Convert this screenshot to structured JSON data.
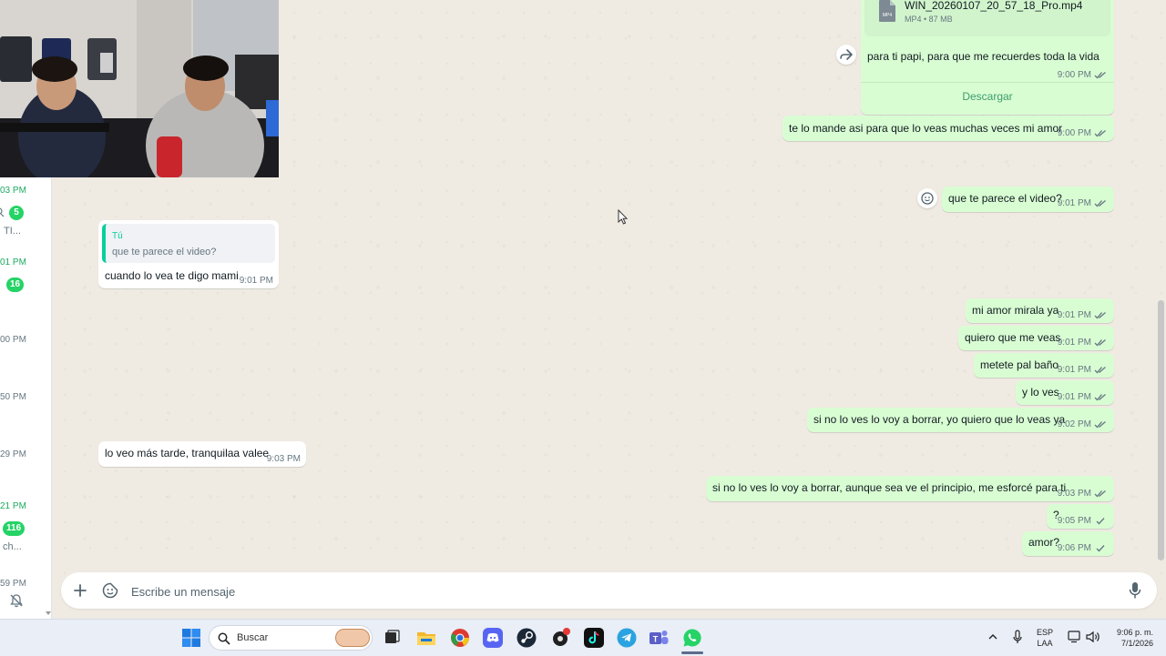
{
  "sidebar_strip": {
    "times": [
      "03 PM",
      "01 PM",
      "00 PM",
      "50 PM",
      "29 PM",
      "21 PM",
      "59 PM"
    ],
    "badges": [
      "5",
      "16",
      "116"
    ],
    "snippets": [
      "TI...",
      "ch..."
    ]
  },
  "messages": {
    "video_file": {
      "name": "WIN_20260107_20_57_18_Pro.mp4",
      "info": "MP4 • 87 MB",
      "icon_label": "MP4",
      "caption": "para ti papi, para que me recuerdes toda la vida",
      "time": "9:00 PM",
      "download_label": "Descargar"
    },
    "m1": {
      "text": "te lo mande asi para que lo veas muchas veces mi amor",
      "time": "9:00 PM"
    },
    "m2": {
      "text": "que te parece el video?",
      "time": "9:01 PM"
    },
    "reply": {
      "quote_author": "Tú",
      "quote_text": "que te parece el video?",
      "text": "cuando lo vea te digo mami",
      "time": "9:01 PM"
    },
    "m3": {
      "text": "mi amor mirala ya",
      "time": "9:01 PM"
    },
    "m4": {
      "text": "quiero que me veas",
      "time": "9:01 PM"
    },
    "m5": {
      "text": "metete pal baño",
      "time": "9:01 PM"
    },
    "m6": {
      "text": "y lo ves",
      "time": "9:01 PM"
    },
    "m7": {
      "text": "si no lo ves lo voy a borrar, yo quiero que lo veas ya",
      "time": "9:02 PM"
    },
    "incoming2": {
      "text": "lo veo más tarde, tranquilaa valee",
      "time": "9:03 PM"
    },
    "m8": {
      "text": "si no lo ves lo voy a borrar, aunque sea ve el principio, me esforcé para ti",
      "time": "9:03 PM"
    },
    "m9": {
      "text": "?",
      "time": "9:05 PM"
    },
    "m10": {
      "text": "amor?",
      "time": "9:06 PM"
    }
  },
  "composer": {
    "placeholder": "Escribe un mensaje"
  },
  "taskbar": {
    "search_label": "Buscar",
    "lang_top": "ESP",
    "lang_bottom": "LAA",
    "clock_time": "9:06 p. m.",
    "clock_date": "7/1/2026"
  },
  "colors": {
    "outgoing_bubble": "#d9fdd3",
    "incoming_bubble": "#ffffff",
    "chat_background": "#efeae2",
    "accent_green": "#25d366",
    "read_tick": "#53bdeb"
  }
}
